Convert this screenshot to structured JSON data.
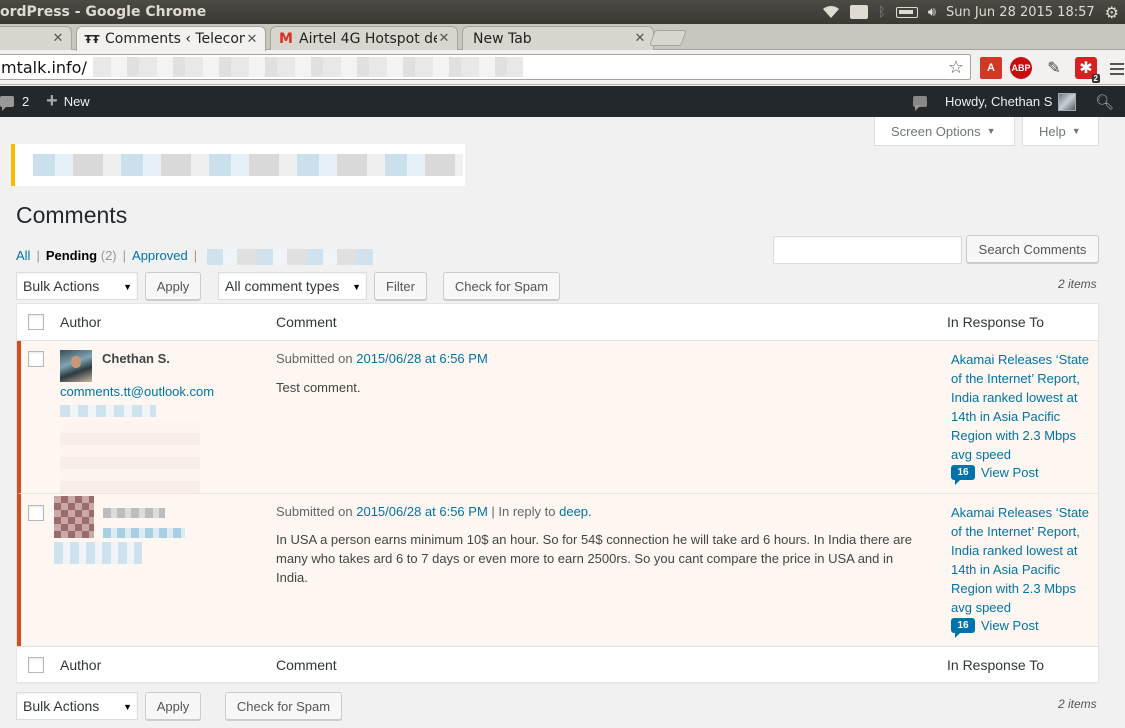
{
  "os": {
    "window_title": "ordPress - Google Chrome",
    "keyboard": "En",
    "datetime": "Sun Jun 28 2015 18:57"
  },
  "browser": {
    "tabs": [
      {
        "label": "",
        "favicon": ""
      },
      {
        "label": "Comments ‹ Telecom",
        "favicon": "ŦŦ"
      },
      {
        "label": "Airtel 4G Hotspot de",
        "favicon": "M"
      },
      {
        "label": "New Tab",
        "favicon": ""
      }
    ],
    "url": "mtalk.info/",
    "ext_counter": "2"
  },
  "admin_bar": {
    "comments_count": "2",
    "new_label": "New",
    "greeting": "Howdy, Chethan S"
  },
  "screen_options": {
    "screen_options_label": "Screen Options",
    "help_label": "Help"
  },
  "page": {
    "title": "Comments",
    "filters": {
      "all": "All",
      "pending": "Pending",
      "pending_count": "(2)",
      "approved": "Approved"
    },
    "search_button": "Search Comments",
    "search_value": "",
    "top_actions": {
      "bulk_actions": "Bulk Actions",
      "apply": "Apply",
      "comment_types": "All comment types",
      "filter": "Filter",
      "check_spam": "Check for Spam",
      "items": "2 items"
    },
    "bottom_actions": {
      "bulk_actions": "Bulk Actions",
      "apply": "Apply",
      "check_spam": "Check for Spam",
      "items": "2 items"
    },
    "columns": {
      "author": "Author",
      "comment": "Comment",
      "response": "In Response To"
    },
    "comments": [
      {
        "author": "Chethan S.",
        "email": "comments.tt@outlook.com",
        "submitted_prefix": "Submitted on",
        "date": "2015/06/28 at 6:56 PM",
        "reply_prefix": "",
        "reply_to": "",
        "text": "Test comment.",
        "response_title": "Akamai Releases ‘State of the Internet’ Report, India ranked lowest at 14th in Asia Pacific Region with 2.3 Mbps avg speed",
        "response_count": "16",
        "view_post": "View Post"
      },
      {
        "author": "",
        "email": "",
        "submitted_prefix": "Submitted on",
        "date": "2015/06/28 at 6:56 PM",
        "reply_prefix": "| In reply to",
        "reply_to": "deep.",
        "text": "In USA a person earns minimum 10$ an hour. So for 54$ connection he will take ard 6 hours. In India there are many who takes ard 6 to 7 days or even more to earn 2500rs. So you cant compare the price in USA and in India.",
        "response_title": "Akamai Releases ‘State of the Internet’ Report, India ranked lowest at 14th in Asia Pacific Region with 2.3 Mbps avg speed",
        "response_count": "16",
        "view_post": "View Post"
      }
    ]
  }
}
